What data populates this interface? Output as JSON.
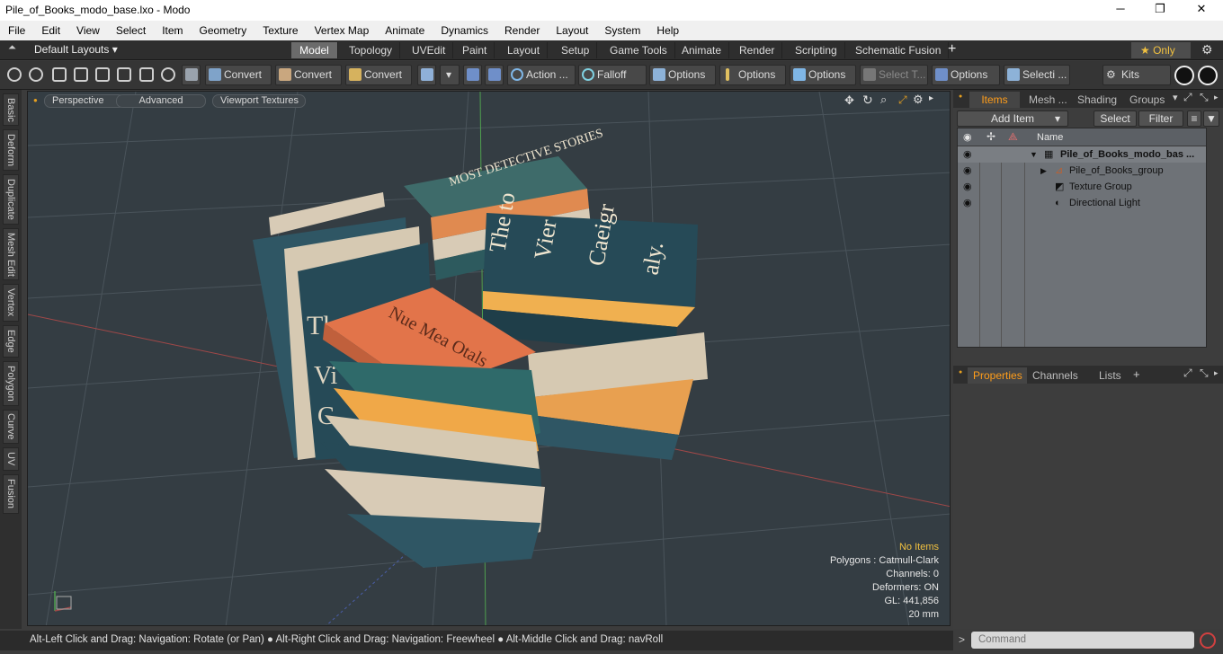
{
  "window": {
    "title": "Pile_of_Books_modo_base.lxo - Modo",
    "minimize": "─",
    "maximize": "❐",
    "close": "✕"
  },
  "menu": [
    "File",
    "Edit",
    "View",
    "Select",
    "Item",
    "Geometry",
    "Texture",
    "Vertex Map",
    "Animate",
    "Dynamics",
    "Render",
    "Layout",
    "System",
    "Help"
  ],
  "layout_selector": "Default Layouts ▾",
  "mode_tabs": [
    "Model",
    "Topology",
    "UVEdit",
    "Paint",
    "Layout",
    "Setup",
    "Game Tools",
    "Animate",
    "Render",
    "Scripting",
    "Schematic Fusion"
  ],
  "active_tab": "Model",
  "add_tab": "+",
  "only_label": "★  Only",
  "toolbar": {
    "convert1": "Convert",
    "convert2": "Convert",
    "convert3": "Convert",
    "action": "Action  ...",
    "falloff": "Falloff",
    "options1": "Options",
    "options2": "Options",
    "options3": "Options",
    "select_t": "Select T...",
    "options4": "Options",
    "selecti": "Selecti ...",
    "kits": "Kits"
  },
  "left_tabs": [
    "Basic",
    "Deform",
    "Duplicate",
    "Mesh Edit",
    "Vertex",
    "Edge",
    "Polygon",
    "Curve",
    "UV",
    "Fusion"
  ],
  "viewport": {
    "perspective": "Perspective",
    "advanced": "Advanced",
    "textures": "Viewport Textures",
    "stats": {
      "no_items": "No Items",
      "polygons": "Polygons : Catmull-Clark",
      "channels": "Channels: 0",
      "deformers": "Deformers: ON",
      "gl": "GL: 441,856",
      "scale": "20 mm"
    },
    "book_titles": {
      "stack1": "Nue Mea Otals",
      "stack2_line1": "The to",
      "stack2_line2": "Vier",
      "stack2_line3": "Caeigr",
      "stack2_line4": "aly.",
      "stack3": "MOST DETECTIVE STORIES",
      "spine1": "The i",
      "spine2": "Vi",
      "spine3": "C"
    }
  },
  "status_bar": "Alt-Left Click and Drag: Navigation: Rotate (or Pan) ● Alt-Right Click and Drag: Navigation: Freewheel ● Alt-Middle Click and Drag: navRoll",
  "items_panel": {
    "tabs": [
      "Items",
      "Mesh ...",
      "Shading",
      "Groups"
    ],
    "add_item": "Add Item",
    "select": "Select",
    "filter": "Filter",
    "name_header": "Name",
    "rows": [
      {
        "label": "Pile_of_Books_modo_bas ...",
        "bold": true
      },
      {
        "label": "Pile_of_Books_group",
        "bold": false
      },
      {
        "label": "Texture Group",
        "bold": false
      },
      {
        "label": "Directional Light",
        "bold": false
      }
    ]
  },
  "properties_panel": {
    "tabs": [
      "Properties",
      "Channels",
      "Lists"
    ],
    "add": "+"
  },
  "command": {
    "prompt": ">",
    "placeholder": "Command"
  },
  "colors": {
    "accent": "#ff9d1a",
    "viewport_bg": "#343d43",
    "selection": "#6b6b6b"
  }
}
